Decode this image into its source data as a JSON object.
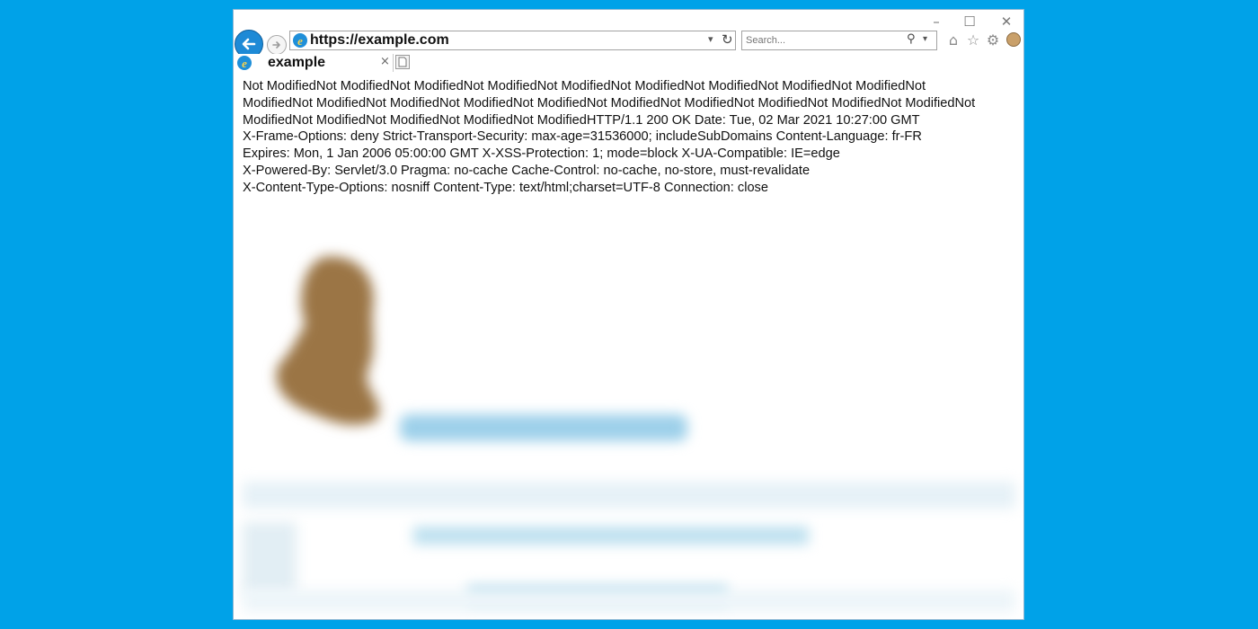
{
  "address_bar": {
    "url": "https://example.com"
  },
  "search": {
    "placeholder": "Search..."
  },
  "tab": {
    "title": "example",
    "close_glyph": "×"
  },
  "window_controls": {
    "minimize": "–",
    "maximize": "☐",
    "close": "✕"
  },
  "toolbar": {
    "icons": [
      "home-icon",
      "star-icon",
      "gear-icon",
      "smiley-icon"
    ]
  },
  "page": {
    "response_text": "Not ModifiedNot ModifiedNot ModifiedNot ModifiedNot ModifiedNot ModifiedNot ModifiedNot ModifiedNot ModifiedNot\nModifiedNot ModifiedNot ModifiedNot ModifiedNot ModifiedNot ModifiedNot ModifiedNot ModifiedNot ModifiedNot ModifiedNot\nModifiedNot ModifiedNot ModifiedNot ModifiedNot ModifiedHTTP/1.1 200 OK Date: Tue, 02 Mar 2021 10:27:00 GMT\nX-Frame-Options: deny Strict-Transport-Security: max-age=31536000; includeSubDomains Content-Language: fr-FR\nExpires: Mon, 1 Jan 2006 05:00:00 GMT X-XSS-Protection: 1; mode=block X-UA-Compatible: IE=edge\nX-Powered-By: Servlet/3.0 Pragma: no-cache Cache-Control: no-cache, no-store, must-revalidate\nX-Content-Type-Options: nosniff Content-Type: text/html;charset=UTF-8 Connection: close"
  },
  "colors": {
    "desktop_background": "#00a2e8",
    "back_button": "#1e8ad6",
    "blurred_logo": "#9b7545",
    "blurred_text": "#9dd0ea"
  }
}
